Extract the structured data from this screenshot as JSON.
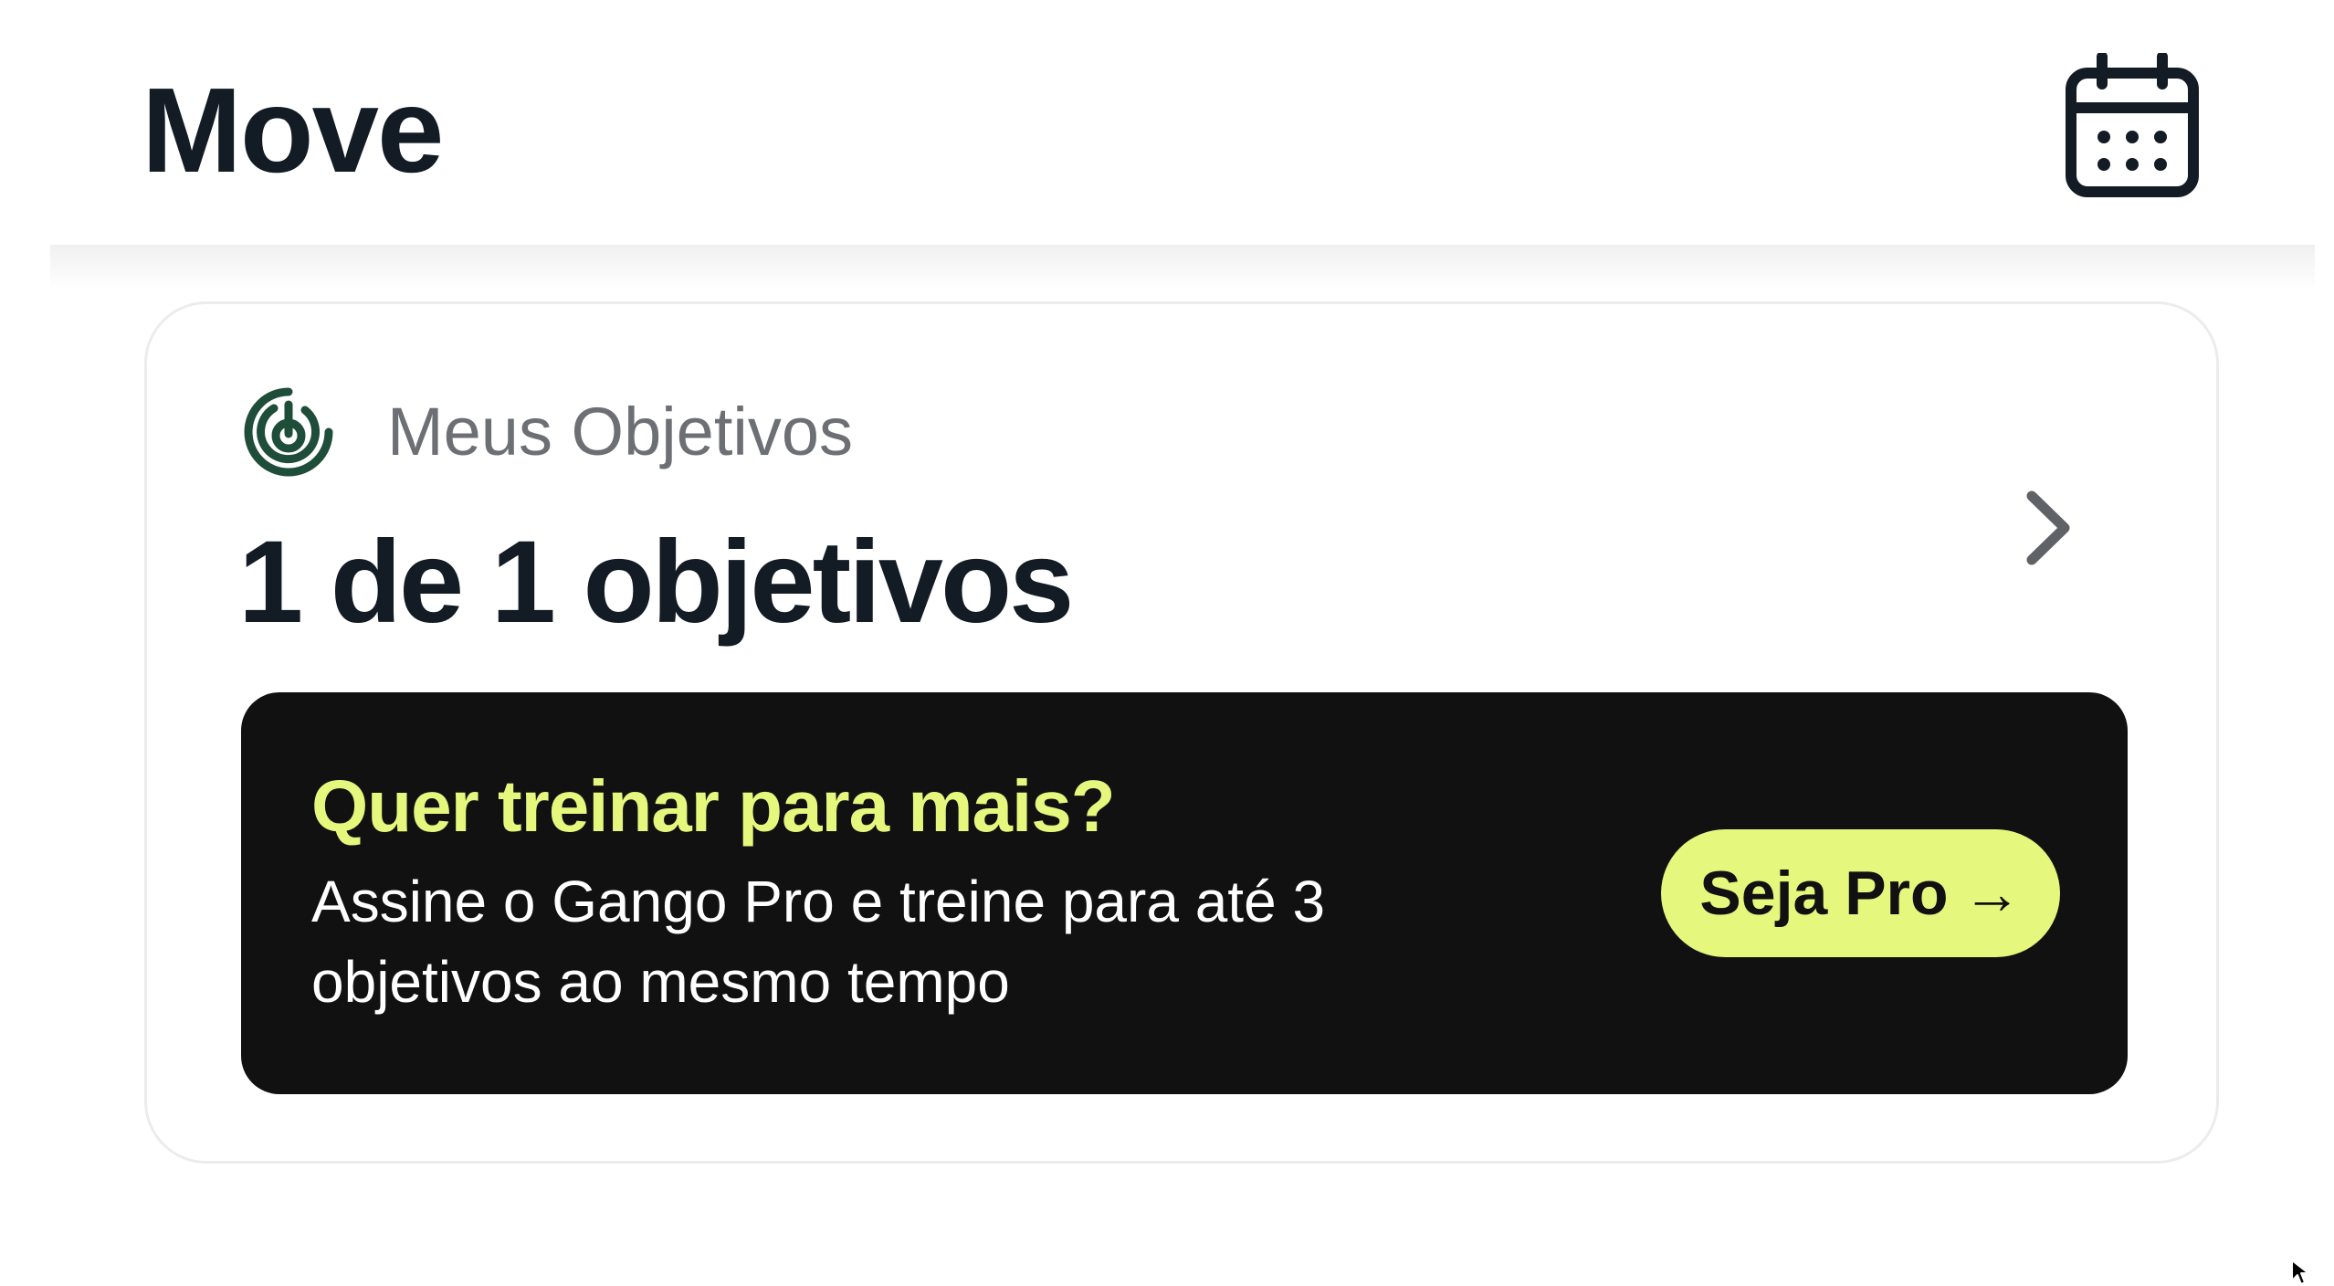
{
  "header": {
    "title": "Move",
    "calendar_icon": "calendar-icon"
  },
  "goals_card": {
    "section_icon": "target-icon",
    "section_label": "Meus Objetivos",
    "count_text": "1 de 1 objetivos",
    "chevron_icon": "chevron-right-icon"
  },
  "promo": {
    "title": "Quer treinar para mais?",
    "text": "Assine o Gango Pro e treine para até 3 objetivos ao mesmo tempo",
    "button_label": "Seja Pro",
    "button_arrow": "→"
  },
  "colors": {
    "text_primary": "#131b24",
    "text_secondary": "#6c6f73",
    "accent": "#e5f77c",
    "promo_background": "#111111",
    "icon_green": "#1e4d3a"
  }
}
